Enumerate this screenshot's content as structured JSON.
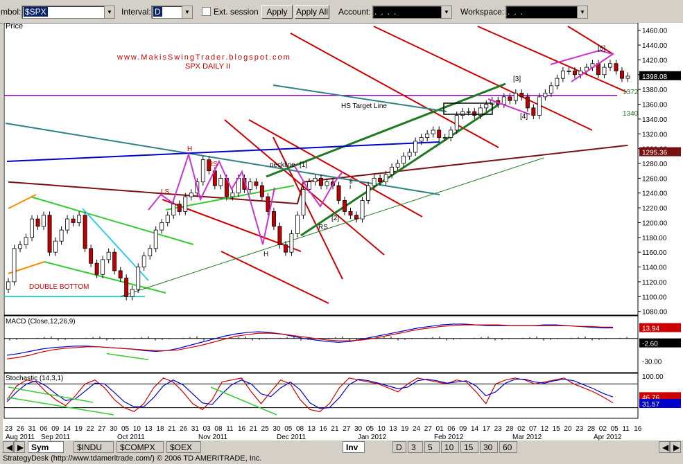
{
  "toolbar": {
    "symbol_label": "mbol:",
    "symbol_value": "$SPX",
    "interval_label": "Interval:",
    "interval_value": "D",
    "ext_session_label": "Ext. session",
    "apply_label": "Apply",
    "apply_all_label": "Apply All",
    "account_label": "Account:",
    "account_value": "....",
    "workspace_label": "Workspace:",
    "workspace_value": "..."
  },
  "chart_data": [
    {
      "type": "candlestick",
      "title": "SPX DAILY  II",
      "watermark": "www.MakisSwingTrader.blogspot.com",
      "ylabel": "Price",
      "ylim": [
        1075,
        1470
      ],
      "y_ticks": [
        1080,
        1100,
        1120,
        1140,
        1160,
        1180,
        1200,
        1220,
        1240,
        1260,
        1280,
        1300,
        1320,
        1340,
        1360,
        1380,
        1400,
        1420,
        1440,
        1460
      ],
      "last_price": "1398.08",
      "ma_value": "1295.36",
      "annotations": [
        "DOUBLE BOTTOM",
        "neckline",
        "HS Target Line",
        "H",
        "RS",
        "LS",
        "RS",
        "H",
        "[1]",
        "[2]",
        "i",
        "ii",
        "[3]",
        "[4]",
        "[5]",
        "1372",
        "1340"
      ],
      "closes": [
        1120,
        1165,
        1170,
        1180,
        1205,
        1195,
        1210,
        1160,
        1175,
        1190,
        1205,
        1200,
        1210,
        1165,
        1145,
        1130,
        1150,
        1160,
        1135,
        1125,
        1100,
        1110,
        1140,
        1155,
        1165,
        1190,
        1200,
        1210,
        1225,
        1215,
        1235,
        1240,
        1255,
        1285,
        1270,
        1250,
        1260,
        1235,
        1240,
        1260,
        1245,
        1255,
        1250,
        1235,
        1215,
        1195,
        1170,
        1160,
        1185,
        1210,
        1245,
        1255,
        1260,
        1250,
        1255,
        1250,
        1230,
        1215,
        1210,
        1205,
        1230,
        1250,
        1260,
        1255,
        1265,
        1275,
        1280,
        1290,
        1295,
        1310,
        1315,
        1320,
        1325,
        1315,
        1315,
        1325,
        1345,
        1350,
        1350,
        1345,
        1355,
        1360,
        1365,
        1360,
        1370,
        1365,
        1375,
        1370,
        1355,
        1345,
        1370,
        1375,
        1385,
        1395,
        1405,
        1405,
        1400,
        1405,
        1410,
        1415,
        1400,
        1410,
        1415,
        1405,
        1395,
        1398
      ]
    },
    {
      "type": "line",
      "title": "MACD (Close,12,26,9)",
      "ylim": [
        -45,
        30
      ],
      "y_ticks": [
        -30
      ],
      "value_labels": [
        "13.94",
        "-2.60"
      ],
      "series": [
        {
          "values": [
            -22,
            -20,
            -17,
            -14,
            -12,
            -11,
            -10,
            -10,
            -11,
            -12,
            -13,
            -14,
            -16,
            -17,
            -16,
            -13,
            -9,
            -5,
            -1,
            3,
            6,
            8,
            9,
            8,
            6,
            3,
            0,
            -2,
            -4,
            -5,
            -4,
            -1,
            2,
            5,
            8,
            11,
            14,
            16,
            18,
            19,
            19,
            18,
            17,
            17,
            17,
            17,
            17,
            18,
            18,
            17,
            16,
            15,
            14,
            14
          ]
        },
        {
          "values": [
            -27,
            -25,
            -22,
            -18,
            -15,
            -13,
            -12,
            -11,
            -11,
            -12,
            -13,
            -14,
            -15,
            -16,
            -16,
            -15,
            -12,
            -9,
            -5,
            -1,
            3,
            5,
            7,
            7,
            6,
            4,
            2,
            0,
            -2,
            -3,
            -3,
            -2,
            0,
            3,
            6,
            9,
            12,
            14,
            16,
            17,
            18,
            18,
            18,
            18,
            17,
            17,
            17,
            17,
            17,
            17,
            16,
            16,
            15,
            15
          ]
        }
      ]
    },
    {
      "type": "line",
      "title": "Stochastic (14,3,1)",
      "ylim": [
        0,
        100
      ],
      "y_ticks": [
        100
      ],
      "value_labels": [
        "46.76",
        "31.57"
      ],
      "series": [
        {
          "values": [
            40,
            75,
            90,
            85,
            60,
            40,
            25,
            50,
            80,
            90,
            70,
            40,
            20,
            10,
            30,
            70,
            95,
            85,
            60,
            30,
            15,
            40,
            85,
            90,
            95,
            60,
            30,
            60,
            90,
            80,
            40,
            15,
            10,
            30,
            70,
            95,
            90,
            85,
            80,
            70,
            60,
            80,
            95,
            90,
            85,
            80,
            90,
            85,
            60,
            30,
            80,
            90,
            95,
            90,
            80,
            85,
            90,
            95,
            80,
            70,
            60,
            47,
            32
          ]
        },
        {
          "values": [
            35,
            60,
            80,
            88,
            75,
            55,
            38,
            42,
            62,
            82,
            80,
            58,
            35,
            22,
            22,
            45,
            75,
            90,
            78,
            55,
            32,
            28,
            55,
            78,
            90,
            80,
            55,
            48,
            70,
            85,
            65,
            32,
            18,
            20,
            45,
            78,
            92,
            88,
            82,
            75,
            68,
            72,
            88,
            92,
            88,
            82,
            85,
            88,
            75,
            50,
            60,
            82,
            92,
            92,
            85,
            82,
            88,
            92,
            88,
            78,
            68,
            56,
            47
          ]
        }
      ]
    },
    {
      "type": "x_axis",
      "day_ticks": [
        "23",
        "26",
        "31",
        "06",
        "09",
        "14",
        "19",
        "22",
        "27",
        "30",
        "05",
        "10",
        "13",
        "18",
        "21",
        "26",
        "31",
        "03",
        "08",
        "11",
        "16",
        "21",
        "25",
        "30",
        "05",
        "08",
        "13",
        "16",
        "21",
        "27",
        "30",
        "05",
        "10",
        "13",
        "19",
        "24",
        "27",
        "01",
        "06",
        "09",
        "14",
        "17",
        "23",
        "28",
        "02",
        "07",
        "12",
        "15",
        "20",
        "23",
        "28",
        "02",
        "05",
        "11",
        "16"
      ],
      "month_labels": [
        "Aug 2011",
        "Sep 2011",
        "Oct 2011",
        "Nov 2011",
        "Dec 2011",
        "Jan 2012",
        "Feb 2012",
        "Mar 2012",
        "Apr 2012"
      ]
    }
  ],
  "tabs": {
    "sym": "Sym",
    "indu": "$INDU",
    "compx": "$COMPX",
    "oex": "$OEX",
    "inv": "Inv",
    "d": "D",
    "t3": "3",
    "t5": "5",
    "t10": "10",
    "t15": "15",
    "t30": "30",
    "t60": "60"
  },
  "status": "StrategyDesk (http://www.tdameritrade.com/) © 2006 TD AMERITRADE, Inc.",
  "colors": {
    "price_bg": "#ffffff",
    "up_candle": "#ffffff",
    "down_candle": "#c00000",
    "channel_red": "#cc0000",
    "green_line": "#33cc33",
    "dark_green": "#1e7a1e",
    "purple": "#9900cc",
    "teal": "#2f8080",
    "blue": "#0000cc",
    "ma": "#7a1010"
  }
}
